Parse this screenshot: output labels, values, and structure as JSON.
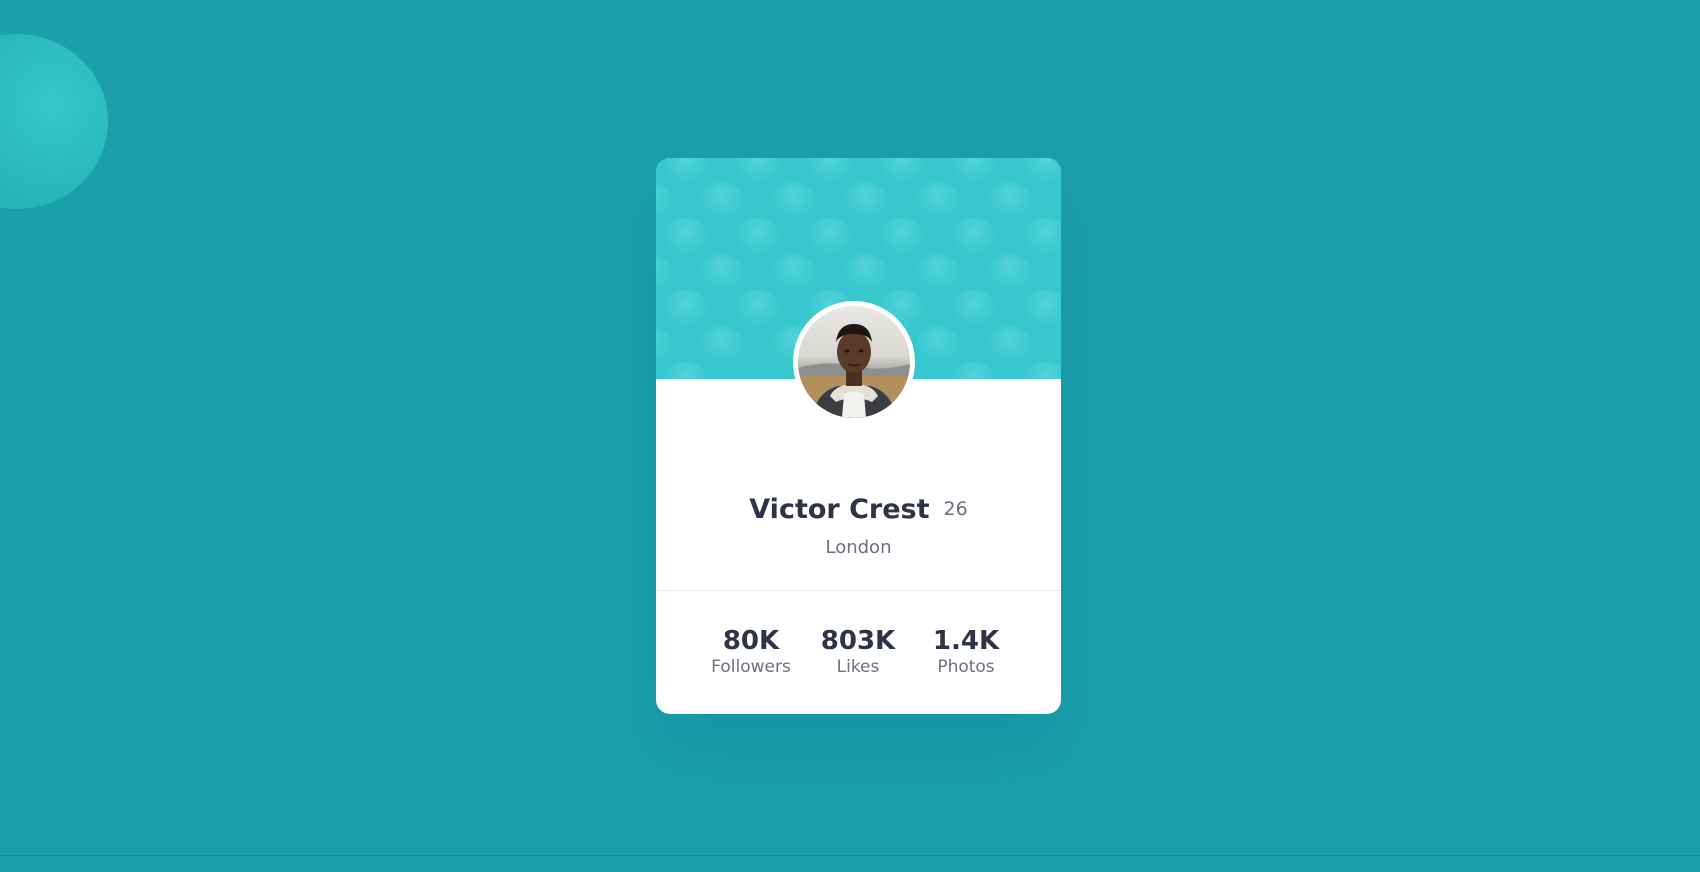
{
  "profile": {
    "name": "Victor Crest",
    "age": "26",
    "city": "London"
  },
  "stats": [
    {
      "value": "80K",
      "label": "Followers"
    },
    {
      "value": "803K",
      "label": "Likes"
    },
    {
      "value": "1.4K",
      "label": "Photos"
    }
  ],
  "colors": {
    "background": "#1aa0ad",
    "header_pattern": "#38c7cf",
    "card": "#ffffff",
    "heading_text": "#2e3349",
    "muted_text": "#6b7082"
  }
}
